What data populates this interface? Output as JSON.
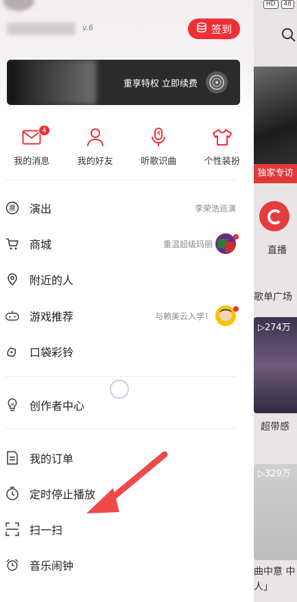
{
  "header": {
    "level": "v.6",
    "checkin_label": "签到"
  },
  "vip": {
    "text": "重享特权 立即续费"
  },
  "quick_actions": [
    {
      "label": "我的消息",
      "badge": "4",
      "icon": "mail-icon"
    },
    {
      "label": "我的好友",
      "icon": "friend-icon"
    },
    {
      "label": "听歌识曲",
      "icon": "mic-icon"
    },
    {
      "label": "个性装扮",
      "icon": "tshirt-icon"
    }
  ],
  "menu": [
    {
      "label": "演出",
      "extra": "李荣浩巡演",
      "icon": "ticket-icon"
    },
    {
      "label": "商城",
      "extra": "重温超级玛丽",
      "icon": "cart-icon"
    },
    {
      "label": "附近的人",
      "extra": "",
      "icon": "location-icon"
    },
    {
      "label": "游戏推荐",
      "extra": "与赖美云入学！",
      "icon": "gamepad-icon"
    },
    {
      "label": "口袋彩铃",
      "extra": "",
      "icon": "ringtone-icon"
    },
    {
      "label": "创作者中心",
      "extra": "",
      "icon": "bulb-icon"
    },
    {
      "label": "我的订单",
      "extra": "",
      "icon": "order-icon"
    },
    {
      "label": "定时停止播放",
      "extra": "",
      "icon": "timer-icon"
    },
    {
      "label": "扫一扫",
      "extra": "",
      "icon": "scan-icon"
    },
    {
      "label": "音乐闹钟",
      "extra": "",
      "icon": "alarm-icon"
    }
  ],
  "background_app": {
    "status_badges": [
      "HD",
      "48"
    ],
    "banner_tag": "独家专访",
    "live_label": "直播",
    "section_title": "歌单广场",
    "card1_count": "▷274万",
    "card1_text": "超带感",
    "card2_count": "▷329万",
    "card2_text": "曲中意 中人」"
  },
  "colors": {
    "accent": "#ef2f36",
    "annotation": "#ee4a4a"
  }
}
